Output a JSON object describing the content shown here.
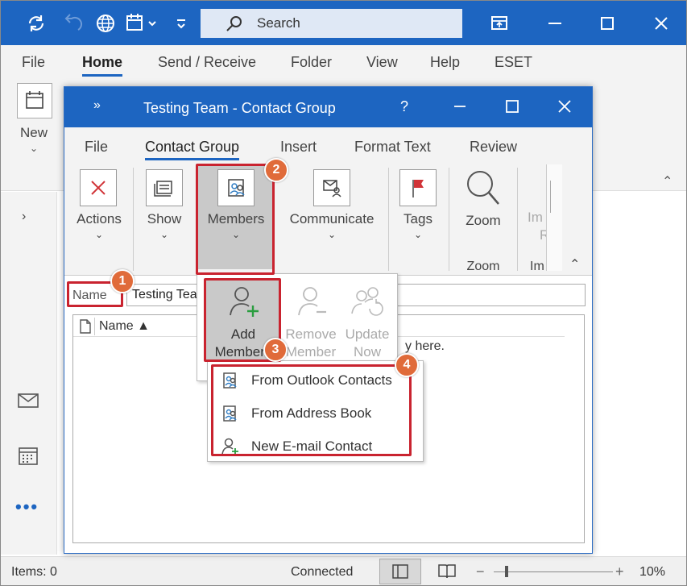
{
  "outlook": {
    "search_placeholder": "Search",
    "menu": [
      "File",
      "Home",
      "Send / Receive",
      "Folder",
      "View",
      "Help",
      "ESET"
    ],
    "new_label": "New",
    "status_items": "Items: 0",
    "status_connected": "Connected",
    "zoom_level": "10%"
  },
  "contact_group": {
    "title": "Testing Team  -  Contact Group",
    "help": "?",
    "tabs": [
      "File",
      "Contact Group",
      "Insert",
      "Format Text",
      "Review"
    ],
    "ribbon": {
      "actions": "Actions",
      "show": "Show",
      "members": "Members",
      "communicate": "Communicate",
      "tags": "Tags",
      "zoom": "Zoom",
      "zoom_group": "Zoom",
      "import_partial": "Im",
      "import_partial2": "R",
      "import_group": "Im"
    },
    "name_label": "Name",
    "name_value": "Testing Tea",
    "list_header": "Name ▲",
    "list_hint": "y here."
  },
  "members_dropdown": {
    "add_line1": "Add",
    "add_line2": "Members",
    "remove_line1": "Remove",
    "remove_line2": "Member",
    "update_line1": "Update",
    "update_line2": "Now"
  },
  "add_menu": {
    "items": [
      "From Outlook Contacts",
      "From Address Book",
      "New E-mail Contact"
    ]
  },
  "badges": [
    "1",
    "2",
    "3",
    "4"
  ],
  "colors": {
    "accent": "#1d65c1",
    "highlight": "#c9232f",
    "badge": "#e06b3a"
  }
}
